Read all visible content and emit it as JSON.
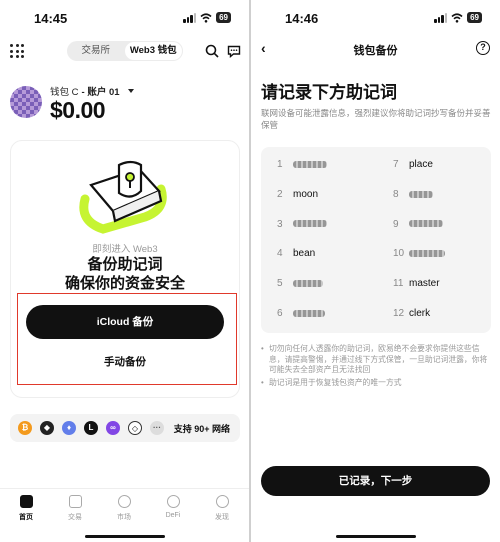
{
  "left": {
    "status": {
      "time": "14:45",
      "battery": "69"
    },
    "tabs": [
      {
        "label": "交易所"
      },
      {
        "label": "Web3 钱包"
      }
    ],
    "wallet": {
      "name": "钱包 C",
      "account": " - 账户 01",
      "balance": "$0.00"
    },
    "backup_card": {
      "subtitle": "即刻进入 Web3",
      "heading_line1": "备份助记词",
      "heading_line2": "确保你的资金安全",
      "icloud_button": "iCloud 备份",
      "manual_button": "手动备份"
    },
    "networks": {
      "label": "支持 90+ 网络",
      "more": "···"
    },
    "bottom_nav": [
      {
        "label": "首页"
      },
      {
        "label": "交易"
      },
      {
        "label": "市场"
      },
      {
        "label": "DeFi"
      },
      {
        "label": "发现"
      }
    ]
  },
  "right": {
    "status": {
      "time": "14:46",
      "battery": "69"
    },
    "nav_title": "钱包备份",
    "back_icon": "chevron-left-icon",
    "help_icon": "help-icon",
    "page_title": "请记录下方助记词",
    "description": "联网设备可能泄露信息，强烈建议你将助记词抄写备份并妥善保管",
    "words": [
      {
        "n": "1",
        "word": "",
        "blurred": true
      },
      {
        "n": "2",
        "word": "moon",
        "blurred": false
      },
      {
        "n": "3",
        "word": "",
        "blurred": true
      },
      {
        "n": "4",
        "word": "bean",
        "blurred": false
      },
      {
        "n": "5",
        "word": "",
        "blurred": true
      },
      {
        "n": "6",
        "word": "",
        "blurred": true
      },
      {
        "n": "7",
        "word": "place",
        "blurred": false
      },
      {
        "n": "8",
        "word": "",
        "blurred": true
      },
      {
        "n": "9",
        "word": "",
        "blurred": true
      },
      {
        "n": "10",
        "word": "",
        "blurred": true
      },
      {
        "n": "11",
        "word": "master",
        "blurred": false
      },
      {
        "n": "12",
        "word": "clerk",
        "blurred": false
      }
    ],
    "bullets": [
      "切勿向任何人透露你的助记词，欧易绝不会要求你提供这些信息，请提高警惕，并通过线下方式保管，一旦助记词泄露，你将可能失去全部资产且无法找回",
      "助记词是用于恢复钱包资产的唯一方式"
    ],
    "next_button": "已记录，下一步"
  },
  "colors": {
    "highlight_box": "#e0392b",
    "accent_green": "#c6f432",
    "primary": "#111111"
  }
}
